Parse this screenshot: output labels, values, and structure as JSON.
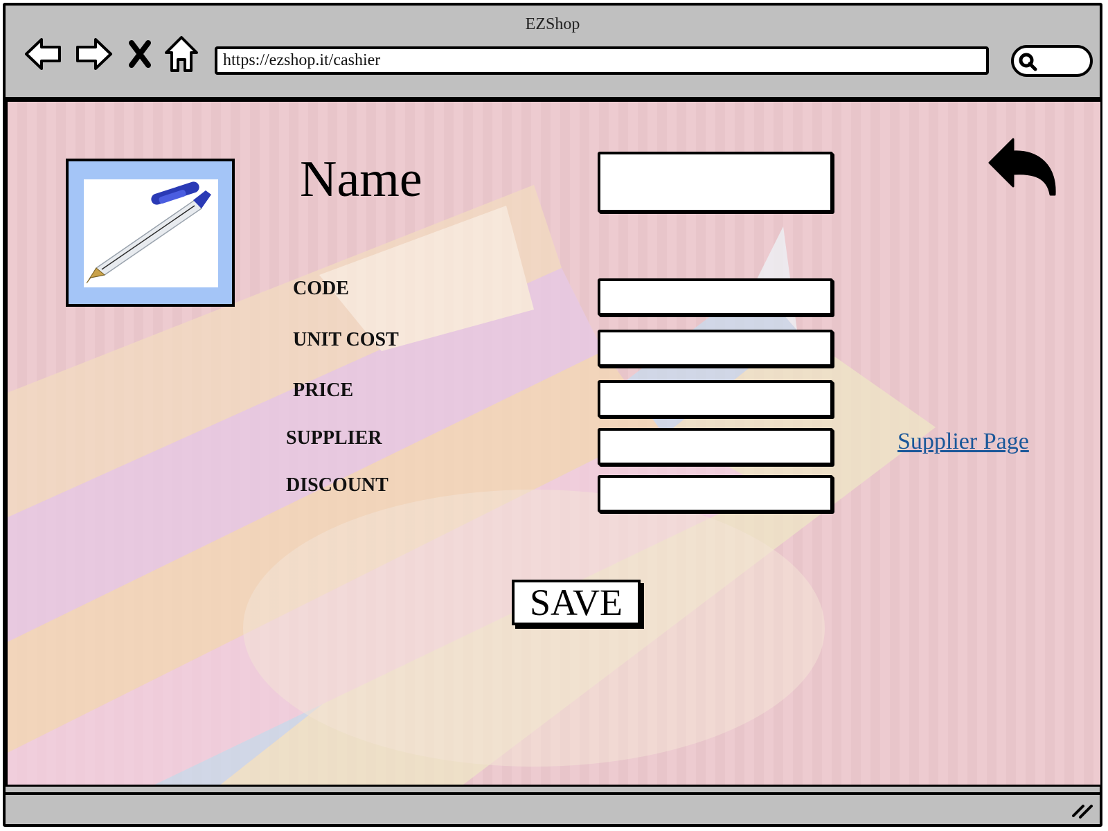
{
  "window": {
    "title": "EZShop"
  },
  "navigation": {
    "back_icon": "arrow-left-icon",
    "forward_icon": "arrow-right-icon",
    "stop_icon": "close-icon",
    "home_icon": "home-icon",
    "search_icon": "search-icon"
  },
  "address_bar": {
    "url": "https://ezshop.it/cashier"
  },
  "product": {
    "image_icon": "pen-image",
    "name_label": "Name",
    "name_value": "",
    "fields": [
      {
        "label": "CODE",
        "value": ""
      },
      {
        "label": "UNIT COST",
        "value": ""
      },
      {
        "label": "PRICE",
        "value": ""
      },
      {
        "label": "SUPPLIER",
        "value": ""
      },
      {
        "label": "DISCOUNT",
        "value": ""
      }
    ],
    "supplier_link": "Supplier Page",
    "save_label": "SAVE",
    "return_icon": "undo-arrow-icon"
  },
  "colors": {
    "chrome": "#c0c0c0",
    "image_frame": "#a4c5f7",
    "link": "#1a5799",
    "page_background": "#ecc8cd"
  }
}
